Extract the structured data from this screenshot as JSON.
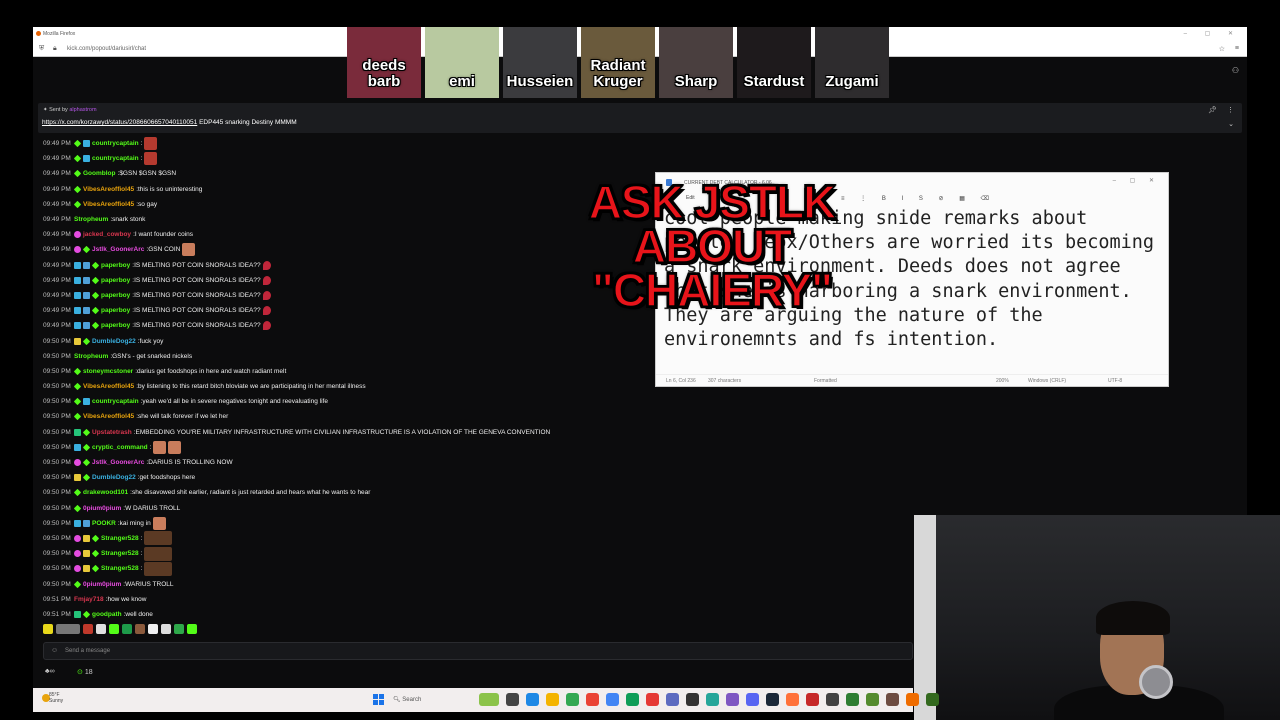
{
  "browser": {
    "title": "Mozilla Firefox",
    "url": "kick.com/popout/dariusirl/chat"
  },
  "people": [
    {
      "name": "deeds barb",
      "bg": "#7a2b3b"
    },
    {
      "name": "emi",
      "bg": "#b8c9a0"
    },
    {
      "name": "Husseien",
      "bg": "#3b3b3e"
    },
    {
      "name": "Radiant Kruger",
      "bg": "#6a5a3c"
    },
    {
      "name": "Sharp",
      "bg": "#4a3f3f"
    },
    {
      "name": "Stardust",
      "bg": "#1e1a1c"
    },
    {
      "name": "Zugami",
      "bg": "#2e2c2e"
    }
  ],
  "pinned": {
    "sent_by_label": "Sent by",
    "sent_by_user": "alphastrom",
    "link": "https://x.com/korzawyd/status/2086606657040110051",
    "text": "EDP445 snarking Destiny MMMM"
  },
  "chat": [
    {
      "ts": "09:49 PM",
      "badges": [
        "gift",
        "sub"
      ],
      "user": "countrycaptain",
      "color": "#53fc18",
      "text": "",
      "emotes": [
        "red"
      ]
    },
    {
      "ts": "09:49 PM",
      "badges": [
        "gift",
        "sub"
      ],
      "user": "countrycaptain",
      "color": "#53fc18",
      "text": "",
      "emotes": [
        "red"
      ]
    },
    {
      "ts": "09:49 PM",
      "badges": [
        "gift"
      ],
      "user": "Goomblop",
      "color": "#53fc18",
      "text": "$GSN $GSN $GSN",
      "emotes": []
    },
    {
      "ts": "09:49 PM",
      "badges": [
        "gift"
      ],
      "user": "VibesAreoffiol45",
      "color": "#e8a30d",
      "text": "this is so uninteresting",
      "emotes": []
    },
    {
      "ts": "09:49 PM",
      "badges": [
        "gift"
      ],
      "user": "VibesAreoffiol45",
      "color": "#e8a30d",
      "text": "so gay",
      "emotes": []
    },
    {
      "ts": "09:49 PM",
      "badges": [],
      "user": "Stropheum",
      "color": "#53fc18",
      "text": "snark stonk",
      "emotes": []
    },
    {
      "ts": "09:49 PM",
      "badges": [
        "pink"
      ],
      "user": "jacked_cowboy",
      "color": "#d9364f",
      "text": "I want founder coins",
      "emotes": []
    },
    {
      "ts": "09:49 PM",
      "badges": [
        "pink",
        "gift"
      ],
      "user": "Jstlk_GoonerArc",
      "color": "#e84ce0",
      "text": "GSN COIN",
      "emotes": [
        "face"
      ]
    },
    {
      "ts": "09:49 PM",
      "badges": [
        "sub",
        "mod",
        "gift"
      ],
      "user": "paperboy",
      "color": "#53fc18",
      "text": "IS MELTING POT COIN SNORALS IDEA??",
      "emotes": [
        "drop"
      ]
    },
    {
      "ts": "09:49 PM",
      "badges": [
        "sub",
        "mod",
        "gift"
      ],
      "user": "paperboy",
      "color": "#53fc18",
      "text": "IS MELTING POT COIN SNORALS IDEA??",
      "emotes": [
        "drop"
      ]
    },
    {
      "ts": "09:49 PM",
      "badges": [
        "sub",
        "mod",
        "gift"
      ],
      "user": "paperboy",
      "color": "#53fc18",
      "text": "IS MELTING POT COIN SNORALS IDEA??",
      "emotes": [
        "drop"
      ]
    },
    {
      "ts": "09:49 PM",
      "badges": [
        "sub",
        "mod",
        "gift"
      ],
      "user": "paperboy",
      "color": "#53fc18",
      "text": "IS MELTING POT COIN SNORALS IDEA??",
      "emotes": [
        "drop"
      ]
    },
    {
      "ts": "09:49 PM",
      "badges": [
        "sub",
        "mod",
        "gift"
      ],
      "user": "paperboy",
      "color": "#53fc18",
      "text": "IS MELTING POT COIN SNORALS IDEA??",
      "emotes": [
        "drop"
      ]
    },
    {
      "ts": "09:50 PM",
      "badges": [
        "gold",
        "gift"
      ],
      "user": "DumbleDog22",
      "color": "#3ab0e0",
      "text": "fuck yoy",
      "emotes": []
    },
    {
      "ts": "09:50 PM",
      "badges": [],
      "user": "Stropheum",
      "color": "#53fc18",
      "text": "GSN's - get snarked nickels",
      "emotes": []
    },
    {
      "ts": "09:50 PM",
      "badges": [
        "gift"
      ],
      "user": "stoneymcstoner",
      "color": "#53fc18",
      "text": "darius get foodshops in here and watch radiant melt",
      "emotes": []
    },
    {
      "ts": "09:50 PM",
      "badges": [
        "gift"
      ],
      "user": "VibesAreoffiol45",
      "color": "#e8a30d",
      "text": "by listening to this retard bitch bloviate we are participating in her mental illness",
      "emotes": []
    },
    {
      "ts": "09:50 PM",
      "badges": [
        "gift",
        "sub"
      ],
      "user": "countrycaptain",
      "color": "#53fc18",
      "text": "yeah we'd all be in severe negatives tonight and reevaluating life",
      "emotes": []
    },
    {
      "ts": "09:50 PM",
      "badges": [
        "gift"
      ],
      "user": "VibesAreoffiol45",
      "color": "#e8a30d",
      "text": "she will talk forever if we let her",
      "emotes": []
    },
    {
      "ts": "09:50 PM",
      "badges": [
        "vip",
        "gift"
      ],
      "user": "Upstatetrash",
      "color": "#d9364f",
      "text": "EMBEDDING YOU'RE MILITARY INFRASTRUCTURE WITH CIVILIAN INFRASTRUCTURE IS A VIOLATION OF THE GENEVA CONVENTION",
      "emotes": []
    },
    {
      "ts": "09:50 PM",
      "badges": [
        "sub",
        "gift"
      ],
      "user": "cryptic_command",
      "color": "#53fc18",
      "text": "",
      "emotes": [
        "face",
        "face"
      ]
    },
    {
      "ts": "09:50 PM",
      "badges": [
        "pink",
        "gift"
      ],
      "user": "Jstlk_GoonerArc",
      "color": "#e84ce0",
      "text": "DARIUS IS TROLLING NOW",
      "emotes": []
    },
    {
      "ts": "09:50 PM",
      "badges": [
        "gold",
        "gift"
      ],
      "user": "DumbleDog22",
      "color": "#3ab0e0",
      "text": "get foodshops here",
      "emotes": []
    },
    {
      "ts": "09:50 PM",
      "badges": [
        "gift"
      ],
      "user": "drakewood101",
      "color": "#53fc18",
      "text": "she disavowed shit earlier, radiant is just retarded and hears what he wants to hear",
      "emotes": []
    },
    {
      "ts": "09:50 PM",
      "badges": [
        "gift"
      ],
      "user": "0pium0pium",
      "color": "#e84ce0",
      "text": "W DARIUS TROLL",
      "emotes": []
    },
    {
      "ts": "09:50 PM",
      "badges": [
        "sub",
        "mod"
      ],
      "user": "POOKR",
      "color": "#53fc18",
      "text": "kai ming in",
      "emotes": [
        "face"
      ]
    },
    {
      "ts": "09:50 PM",
      "badges": [
        "pink",
        "gold",
        "gift"
      ],
      "user": "Stranger528",
      "color": "#53fc18",
      "text": "",
      "emotes": [
        "box"
      ]
    },
    {
      "ts": "09:50 PM",
      "badges": [
        "pink",
        "gold",
        "gift"
      ],
      "user": "Stranger528",
      "color": "#53fc18",
      "text": "",
      "emotes": [
        "box"
      ]
    },
    {
      "ts": "09:50 PM",
      "badges": [
        "pink",
        "gold",
        "gift"
      ],
      "user": "Stranger528",
      "color": "#53fc18",
      "text": "",
      "emotes": [
        "box"
      ]
    },
    {
      "ts": "09:50 PM",
      "badges": [
        "gift"
      ],
      "user": "0pium0pium",
      "color": "#e84ce0",
      "text": "WARIUS TROLL",
      "emotes": []
    },
    {
      "ts": "09:51 PM",
      "badges": [],
      "user": "Fmjay718",
      "color": "#d9364f",
      "text": "how we know",
      "emotes": []
    },
    {
      "ts": "09:51 PM",
      "badges": [
        "vip",
        "gift"
      ],
      "user": "goodpath",
      "color": "#53fc18",
      "text": "well done",
      "emotes": []
    }
  ],
  "input": {
    "placeholder": "Send a message"
  },
  "footer": {
    "viewer_count": "18"
  },
  "notepad": {
    "title": "CURRENT DEBT CALCULATOR - 6.06",
    "menu": "Edit",
    "body": "cool people making snide remarks about people. Meox/Others are worried its becoming a snark environment. Deeds does not agree that she is harboring a snark environment. They are arguing the nature of the environemnts and fs intention.",
    "status_pos": "Ln 6, Col 236",
    "status_chars": "307 characters",
    "status_format": "Formatted",
    "status_zoom": "200%",
    "status_eol": "Windows (CRLF)",
    "status_enc": "UTF-8"
  },
  "overlay": {
    "line1": "ASK JSTLK",
    "line2": "ABOUT",
    "line3": "\"CHAIERY\""
  },
  "taskbar": {
    "temp": "85°F",
    "condition": "Sunny",
    "search": "Search"
  }
}
